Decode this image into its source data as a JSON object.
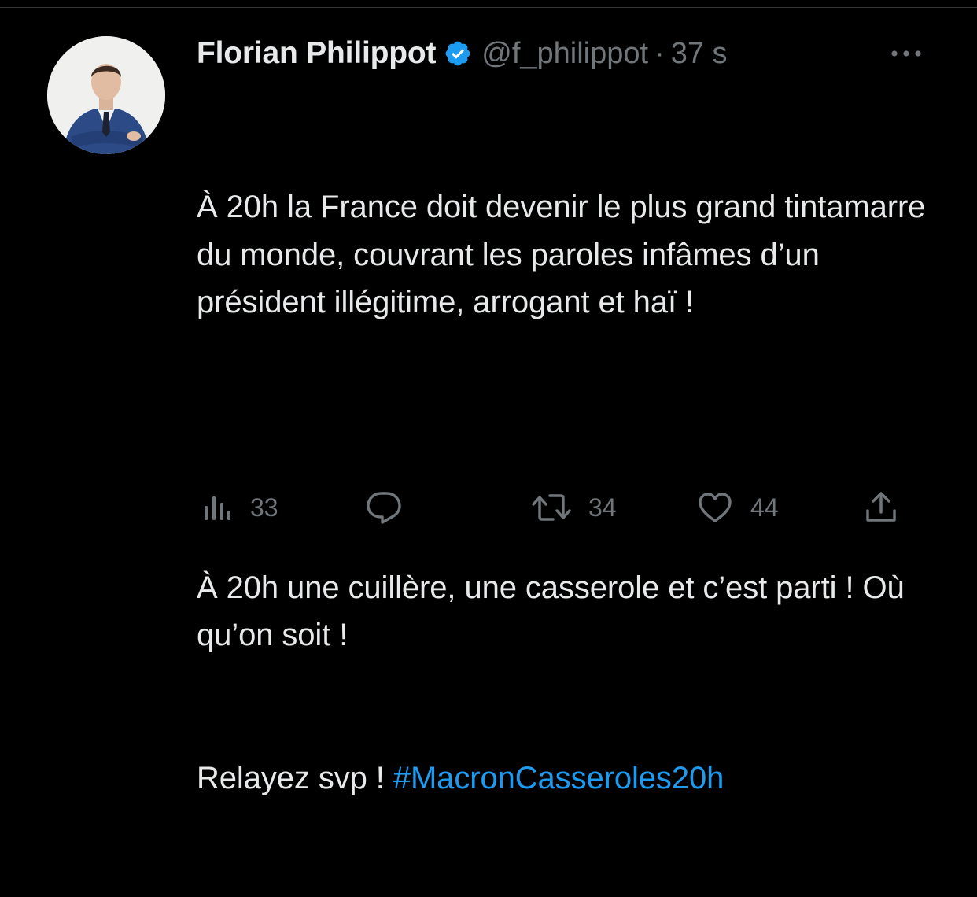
{
  "tweet": {
    "author_name": "Florian Philippot",
    "handle": "@f_philippot",
    "separator": "·",
    "time": "37 s",
    "text": {
      "p1": "À 20h la France doit devenir le plus grand tintamarre du monde, couvrant les paroles infâmes d’un président illégitime, arrogant et haï !",
      "p2_line1": "À 20h une cuillère, une casserole et c’est parti ! Où qu’on soit !",
      "p2_line2": "Relayez svp ! ",
      "hashtag": "#MacronCasseroles20h"
    },
    "actions": {
      "views": "33",
      "replies": "",
      "retweets": "34",
      "likes": "44"
    }
  },
  "colors": {
    "background": "#000000",
    "text": "#e7e9ea",
    "muted": "#71767b",
    "accent": "#1d9bf0"
  },
  "icons": [
    "verified-badge-icon",
    "more-options-icon",
    "views-icon",
    "reply-icon",
    "retweet-icon",
    "like-icon",
    "share-icon"
  ]
}
